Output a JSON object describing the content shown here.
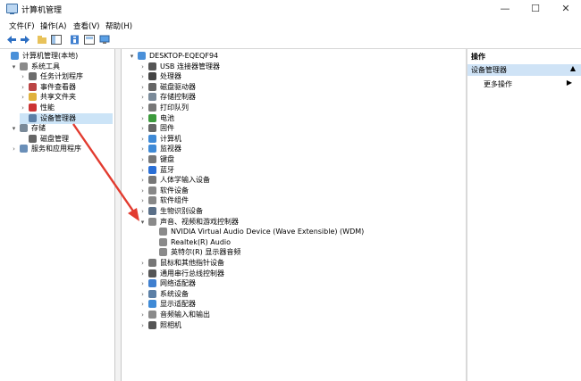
{
  "window": {
    "title": "计算机管理"
  },
  "menubar": [
    "文件(F)",
    "操作(A)",
    "查看(V)",
    "帮助(H)"
  ],
  "left_tree": [
    {
      "label": "计算机管理(本地)",
      "level": 0,
      "arrow": "",
      "icon": "computer"
    },
    {
      "label": "系统工具",
      "level": 1,
      "arrow": "▾",
      "icon": "tools"
    },
    {
      "label": "任务计划程序",
      "level": 2,
      "arrow": "›",
      "icon": "clock"
    },
    {
      "label": "事件查看器",
      "level": 2,
      "arrow": "›",
      "icon": "event"
    },
    {
      "label": "共享文件夹",
      "level": 2,
      "arrow": "›",
      "icon": "folder"
    },
    {
      "label": "性能",
      "level": 2,
      "arrow": "›",
      "icon": "perf"
    },
    {
      "label": "设备管理器",
      "level": 2,
      "arrow": "",
      "icon": "devmgr",
      "selected": true
    },
    {
      "label": "存储",
      "level": 1,
      "arrow": "▾",
      "icon": "storage"
    },
    {
      "label": "磁盘管理",
      "level": 2,
      "arrow": "",
      "icon": "disk"
    },
    {
      "label": "服务和应用程序",
      "level": 1,
      "arrow": "›",
      "icon": "services"
    }
  ],
  "device_tree": [
    {
      "label": "DESKTOP-EQEQF94",
      "level": 0,
      "arrow": "▾",
      "icon": "computer"
    },
    {
      "label": "USB 连接器管理器",
      "level": 1,
      "arrow": "›",
      "icon": "usb"
    },
    {
      "label": "处理器",
      "level": 1,
      "arrow": "›",
      "icon": "cpu"
    },
    {
      "label": "磁盘驱动器",
      "level": 1,
      "arrow": "›",
      "icon": "disk"
    },
    {
      "label": "存储控制器",
      "level": 1,
      "arrow": "›",
      "icon": "storage"
    },
    {
      "label": "打印队列",
      "level": 1,
      "arrow": "›",
      "icon": "printer"
    },
    {
      "label": "电池",
      "level": 1,
      "arrow": "›",
      "icon": "battery"
    },
    {
      "label": "固件",
      "level": 1,
      "arrow": "›",
      "icon": "firmware"
    },
    {
      "label": "计算机",
      "level": 1,
      "arrow": "›",
      "icon": "monitor"
    },
    {
      "label": "监视器",
      "level": 1,
      "arrow": "›",
      "icon": "monitor"
    },
    {
      "label": "键盘",
      "level": 1,
      "arrow": "›",
      "icon": "keyboard"
    },
    {
      "label": "蓝牙",
      "level": 1,
      "arrow": "›",
      "icon": "bluetooth"
    },
    {
      "label": "人体学输入设备",
      "level": 1,
      "arrow": "›",
      "icon": "hid"
    },
    {
      "label": "软件设备",
      "level": 1,
      "arrow": "›",
      "icon": "software"
    },
    {
      "label": "软件组件",
      "level": 1,
      "arrow": "›",
      "icon": "software"
    },
    {
      "label": "生物识别设备",
      "level": 1,
      "arrow": "›",
      "icon": "biometric"
    },
    {
      "label": "声音、视频和游戏控制器",
      "level": 1,
      "arrow": "▾",
      "icon": "speaker"
    },
    {
      "label": "NVIDIA Virtual Audio Device (Wave Extensible) (WDM)",
      "level": 2,
      "arrow": "",
      "icon": "speaker"
    },
    {
      "label": "Realtek(R) Audio",
      "level": 2,
      "arrow": "",
      "icon": "speaker"
    },
    {
      "label": "英特尔(R) 显示器音频",
      "level": 2,
      "arrow": "",
      "icon": "speaker"
    },
    {
      "label": "鼠标和其他指针设备",
      "level": 1,
      "arrow": "›",
      "icon": "mouse"
    },
    {
      "label": "通用串行总线控制器",
      "level": 1,
      "arrow": "›",
      "icon": "usb"
    },
    {
      "label": "网络适配器",
      "level": 1,
      "arrow": "›",
      "icon": "network"
    },
    {
      "label": "系统设备",
      "level": 1,
      "arrow": "›",
      "icon": "system"
    },
    {
      "label": "显示适配器",
      "level": 1,
      "arrow": "›",
      "icon": "display"
    },
    {
      "label": "音频输入和输出",
      "level": 1,
      "arrow": "›",
      "icon": "speaker"
    },
    {
      "label": "照相机",
      "level": 1,
      "arrow": "›",
      "icon": "camera"
    }
  ],
  "actions": {
    "header": "操作",
    "selected": "设备管理器",
    "more": "更多操作"
  },
  "colors": {
    "accent": "#cce4f7",
    "annotation_arrow": "#e23b2f"
  }
}
